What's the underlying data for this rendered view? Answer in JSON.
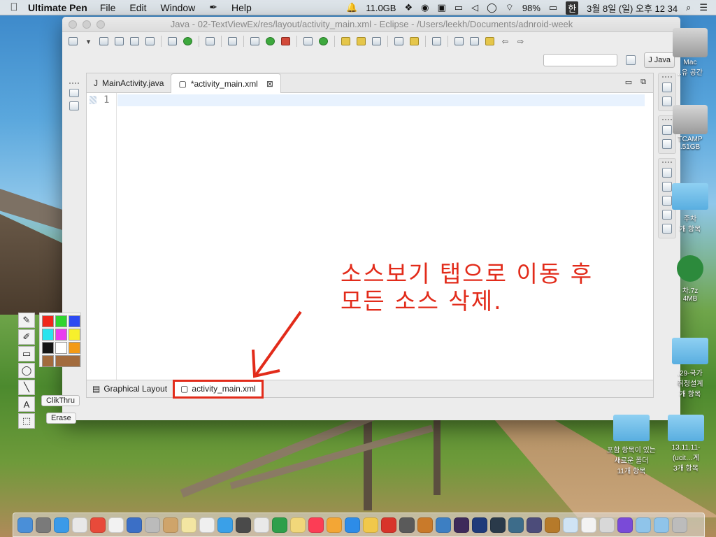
{
  "menubar": {
    "app_name": "Ultimate Pen",
    "items": [
      "File",
      "Edit",
      "Window",
      "Help"
    ],
    "memory": "11.0GB",
    "battery": "98%",
    "input_method": "한",
    "clock": "3월 8일 (일) 오후  12 34"
  },
  "window": {
    "title": "Java - 02-TextViewEx/res/layout/activity_main.xml - Eclipse - /Users/leekh/Documents/adnroid-week",
    "perspective": "Java"
  },
  "editor": {
    "tabs": [
      {
        "label": "MainActivity.java"
      },
      {
        "label": "*activity_main.xml"
      }
    ],
    "line_numbers": [
      "1"
    ],
    "bottom_tabs": [
      {
        "label": "Graphical Layout"
      },
      {
        "label": "activity_main.xml"
      }
    ]
  },
  "pen": {
    "clickthru_label": "ClikThru",
    "erase_label": "Erase",
    "text_tool": "A",
    "colors": [
      "#f0271a",
      "#2fd52f",
      "#2d4bf2",
      "#28e4ee",
      "#e93cf0",
      "#f7f02c",
      "#151515",
      "#ffffff",
      "#f39a16",
      "#a26b3d",
      "#a26b3d"
    ]
  },
  "annotation": {
    "text": "소스보기 탭으로 이동 후\n모든 소스 삭제.",
    "color": "#e22b1a"
  },
  "desktop": {
    "icons": [
      {
        "label": "Mac\n..유 공간"
      },
      {
        "label": "TCAMP\n.51GB"
      },
      {
        "label": "주차\n개 항목"
      },
      {
        "label": "차.7z\n4MB"
      },
      {
        "label": ".29-국가\n취정설계\n개 항목"
      },
      {
        "label": "포함 항목이 있는\n새로운 폴더\n11개 항목"
      },
      {
        "label": "13.11.11-\n(ucit…계\n3개 항목"
      }
    ]
  },
  "dock": {
    "icon_colors": [
      "#4a8fd8",
      "#7a7a7a",
      "#3a9ae8",
      "#e8e8e8",
      "#e84a3a",
      "#f2f2f2",
      "#3b6fc6",
      "#bbbbbb",
      "#cfa46a",
      "#f3e6a2",
      "#efefef",
      "#3aa0e8",
      "#4a4a4a",
      "#e9e9e9",
      "#2d9f4a",
      "#f1d77a",
      "#fc3d55",
      "#f3a635",
      "#2d8ce8",
      "#f1c84a",
      "#d8342a",
      "#5a5a5a",
      "#c97a2a",
      "#3d7fc3",
      "#3e2a5a",
      "#1f3a7a",
      "#2a3a4a",
      "#3d6c8a",
      "#4c4c7a",
      "#b67a2a",
      "#cfe3f4",
      "#f3f3f3",
      "#d8d8d8",
      "#7a4ad8",
      "#8fc4ea",
      "#8fc4ea",
      "#bcbcbc"
    ]
  }
}
